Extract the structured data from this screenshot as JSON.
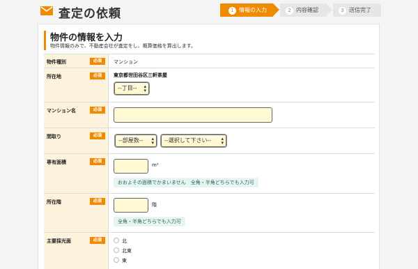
{
  "header": {
    "title": "査定の依頼",
    "mail_icon": "envelope-icon",
    "accent_color": "#f08a00"
  },
  "steps": [
    {
      "num": "1",
      "label": "情報の入力",
      "active": true
    },
    {
      "num": "2",
      "label": "内容確認",
      "active": false
    },
    {
      "num": "3",
      "label": "送信完了",
      "active": false
    }
  ],
  "section": {
    "title": "物件の情報を入力",
    "subtitle": "物件情報のみで、不動産会社が査定をし、概算価格を算出します。"
  },
  "required_badge": "必須",
  "rows": {
    "property_type": {
      "label": "物件種別",
      "value": "マンション"
    },
    "location": {
      "label": "所在地",
      "address": "東京都世田谷区三軒茶屋",
      "chome_select": "--丁目--"
    },
    "mansion_name": {
      "label": "マンション名",
      "value": "",
      "placeholder": ""
    },
    "layout": {
      "label": "間取り",
      "rooms_select": "--部屋数--",
      "type_select": "--選択して下さい--"
    },
    "area": {
      "label": "専有面積",
      "value": "",
      "unit": "m²",
      "hint": "おおよその面積でかまいません　全角・半角どちらでも入力可"
    },
    "floor": {
      "label": "所在階",
      "value": "",
      "unit": "階",
      "hint": "全角・半角どちらでも入力可"
    },
    "orientation": {
      "label": "主要採光面",
      "options": [
        "北",
        "北東",
        "東"
      ]
    }
  }
}
